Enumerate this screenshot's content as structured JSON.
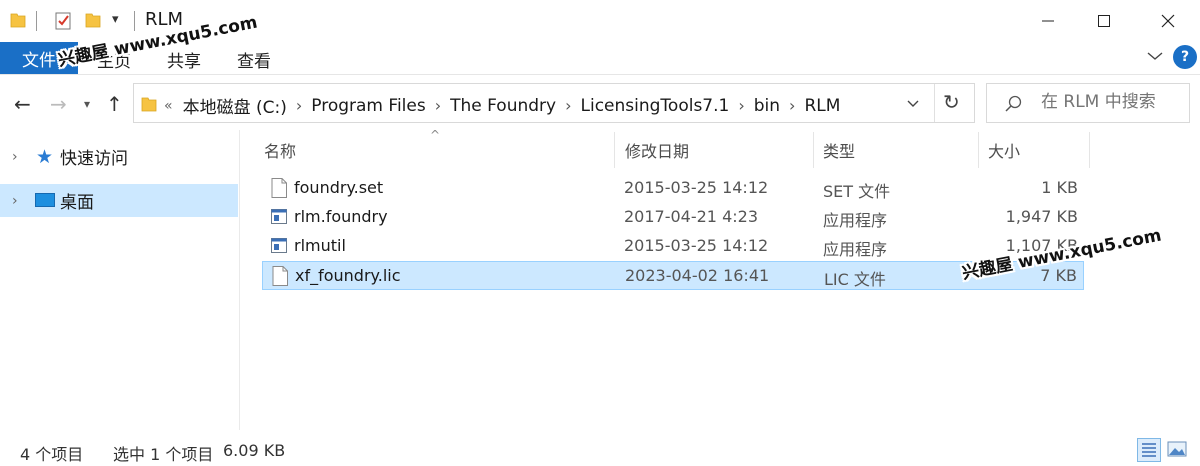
{
  "window": {
    "title": "RLM",
    "quick_access_dropdown": "▾"
  },
  "ribbon": {
    "file_tab": "文件",
    "tabs": [
      "主页",
      "共享",
      "查看"
    ],
    "help": "?"
  },
  "address": {
    "overflow": "«",
    "breadcrumbs": [
      "本地磁盘 (C:)",
      "Program Files",
      "The Foundry",
      "LicensingTools7.1",
      "bin",
      "RLM"
    ],
    "separator": "›"
  },
  "search": {
    "placeholder": "在 RLM 中搜索"
  },
  "nav_pane": {
    "items": [
      {
        "label": "快速访问",
        "icon": "star-icon",
        "selected": false
      },
      {
        "label": "桌面",
        "icon": "desktop-icon",
        "selected": true
      }
    ]
  },
  "file_list": {
    "sort_indicator": "^",
    "columns": {
      "name": "名称",
      "date": "修改日期",
      "type": "类型",
      "size": "大小"
    },
    "rows": [
      {
        "name": "foundry.set",
        "date": "2015-03-25 14:12",
        "type": "SET 文件",
        "size": "1 KB",
        "icon": "document-icon",
        "selected": false
      },
      {
        "name": "rlm.foundry",
        "date": "2017-04-21 4:23",
        "type": "应用程序",
        "size": "1,947 KB",
        "icon": "application-icon",
        "selected": false
      },
      {
        "name": "rlmutil",
        "date": "2015-03-25 14:12",
        "type": "应用程序",
        "size": "1,107 KB",
        "icon": "application-icon",
        "selected": false
      },
      {
        "name": "xf_foundry.lic",
        "date": "2023-04-02 16:41",
        "type": "LIC 文件",
        "size": "7 KB",
        "icon": "document-icon",
        "selected": true
      }
    ]
  },
  "status_bar": {
    "item_count": "4 个项目",
    "selection": "选中 1 个项目",
    "selection_size": "6.09 KB"
  },
  "watermarks": [
    "兴趣屋 www.xqu5.com",
    "兴趣屋 www.xqu5.com"
  ],
  "colors": {
    "accent": "#1a6fc6",
    "selection": "#cce8ff",
    "selection_border": "#99d1ff"
  }
}
